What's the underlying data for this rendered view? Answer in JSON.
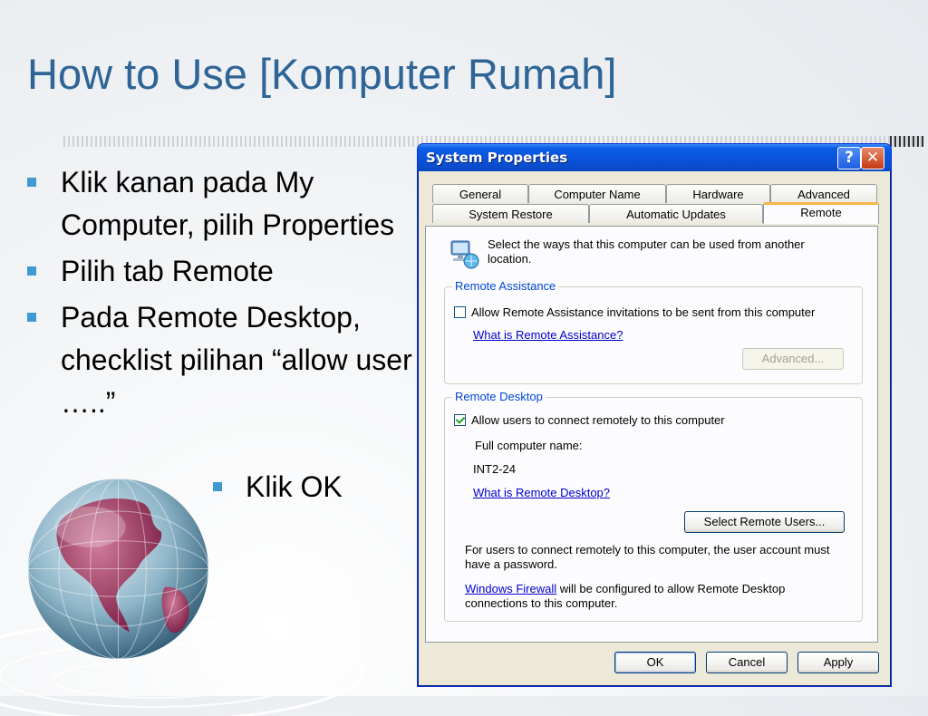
{
  "slide": {
    "title": "How to Use [Komputer Rumah]",
    "bullets": [
      "Klik kanan pada My Computer, pilih Properties",
      "Pilih tab Remote",
      "Pada Remote Desktop, checklist pilihan “allow user …..”"
    ],
    "sub_bullet": "Klik OK"
  },
  "dialog": {
    "title": "System Properties",
    "help_glyph": "?",
    "close_glyph": "✕",
    "tabs_row1": [
      "General",
      "Computer Name",
      "Hardware",
      "Advanced"
    ],
    "tabs_row2": [
      "System Restore",
      "Automatic Updates",
      "Remote"
    ],
    "active_tab": "Remote",
    "intro": "Select the ways that this computer can be used from another location.",
    "remote_assistance": {
      "legend": "Remote Assistance",
      "checkbox_label": "Allow Remote Assistance invitations to be sent from this computer",
      "checked": false,
      "link": "What is Remote Assistance?",
      "advanced_button": "Advanced..."
    },
    "remote_desktop": {
      "legend": "Remote Desktop",
      "checkbox_label": "Allow users to connect remotely to this computer",
      "checked": true,
      "full_name_label": "Full computer name:",
      "computer_name": "INT2-24",
      "link": "What is Remote Desktop?",
      "select_users_button": "Select Remote Users...",
      "note": "For users to connect remotely to this computer, the user account must have a password.",
      "firewall_link": "Windows Firewall",
      "firewall_text": " will be configured to allow Remote Desktop connections to this computer."
    },
    "buttons": {
      "ok": "OK",
      "cancel": "Cancel",
      "apply": "Apply"
    }
  },
  "colors": {
    "title": "#2e6496",
    "bullet": "#3f9ad4",
    "xp_titlebar": "#0a52d8",
    "dialog_bg": "#ece9d8",
    "link": "#0000cc",
    "legend": "#0046d5"
  }
}
